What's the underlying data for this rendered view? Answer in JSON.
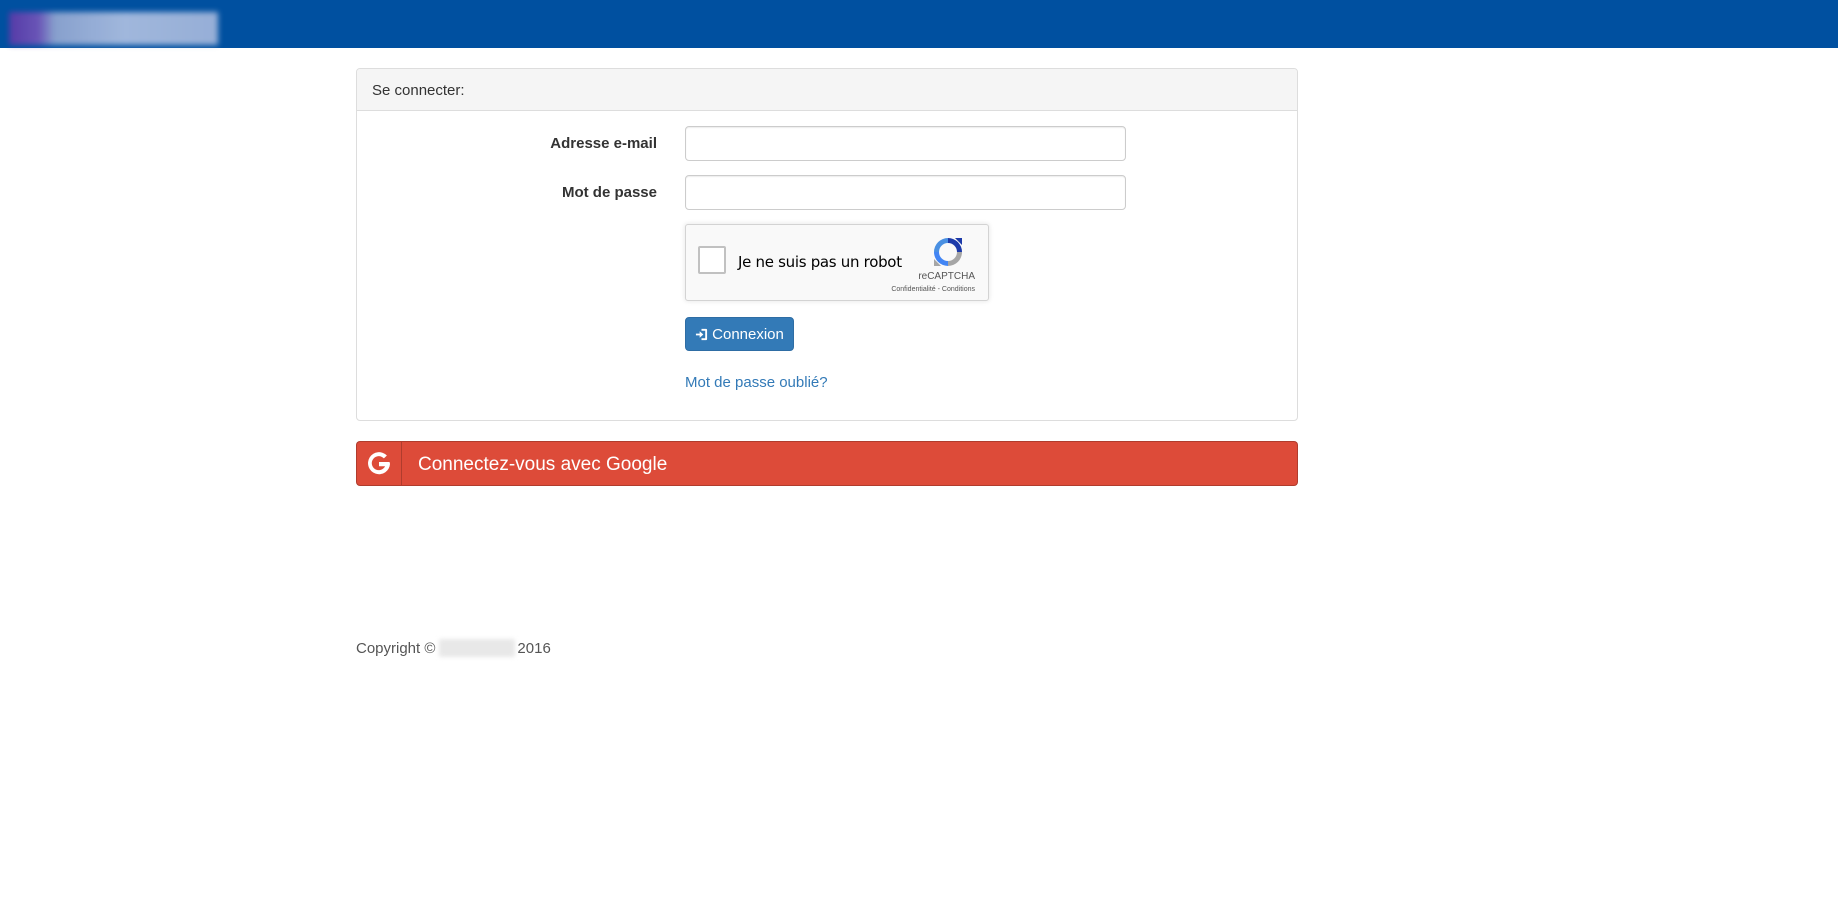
{
  "panel": {
    "heading": "Se connecter:"
  },
  "form": {
    "email_label": "Adresse e-mail",
    "email_value": "",
    "password_label": "Mot de passe",
    "password_value": "",
    "login_button": "Connexion",
    "forgot_link": "Mot de passe oublié?"
  },
  "recaptcha": {
    "label": "Je ne suis pas un robot",
    "brand": "reCAPTCHA",
    "links": "Confidentialité - Conditions"
  },
  "google": {
    "label": "Connectez-vous avec Google",
    "icon": "google-icon",
    "color": "#dd4b39"
  },
  "footer": {
    "copyright_prefix": "Copyright ©",
    "year": "2016"
  },
  "colors": {
    "topbar": "#0050a0",
    "primary": "#337ab7"
  }
}
